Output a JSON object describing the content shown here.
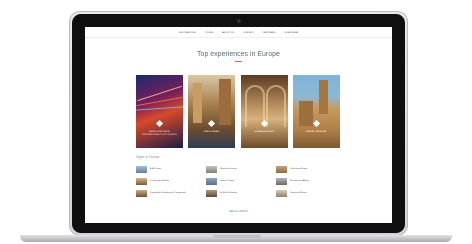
{
  "nav": {
    "items": [
      "DESTINATIONS",
      "TOURS",
      "ABOUT US",
      "CONTACT",
      "PARTNERS",
      "SUBSCRIBE"
    ]
  },
  "heading": {
    "title": "Top experiences in Europe"
  },
  "cards": [
    {
      "caption": "Berlin Light Show",
      "sub": "Experience and tour of Berlin"
    },
    {
      "caption": "Venice Canals",
      "sub": ""
    },
    {
      "caption": "Alhambra Palace",
      "sub": ""
    },
    {
      "caption": "Iberian Cathedral",
      "sub": ""
    }
  ],
  "sights": {
    "label": "Sights in Europe",
    "items": [
      {
        "label": "Eiffel Tower"
      },
      {
        "label": "Musée du Louvre"
      },
      {
        "label": "Colosseum Rome"
      },
      {
        "label": "La Sagrada Familia"
      },
      {
        "label": "Sistine Chapel"
      },
      {
        "label": "Westminster Abbey"
      },
      {
        "label": "Catedral de Santiago de Compostela"
      },
      {
        "label": "St Mark's Basilica"
      },
      {
        "label": "Duomo di Milano"
      }
    ]
  },
  "footer": {
    "link": "SEE ALL SIGHTS"
  },
  "colors": {
    "accent": "#e05a47",
    "link": "#4a7ec4",
    "title": "#5f6b7c"
  }
}
